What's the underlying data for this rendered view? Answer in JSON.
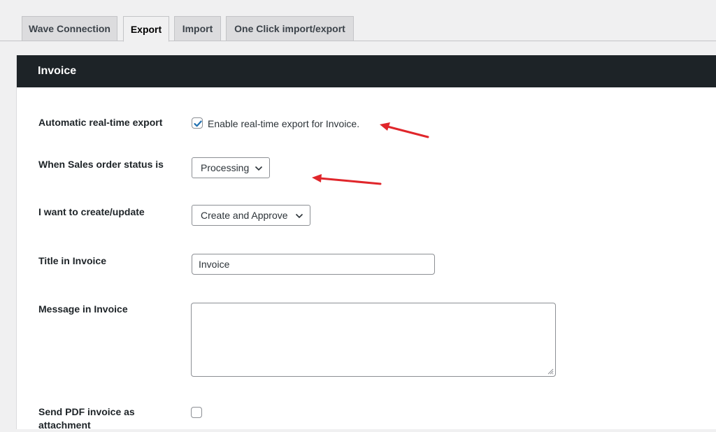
{
  "tabs": [
    {
      "label": "Wave Connection",
      "active": false
    },
    {
      "label": "Export",
      "active": true
    },
    {
      "label": "Import",
      "active": false
    },
    {
      "label": "One Click import/export",
      "active": false
    }
  ],
  "panel": {
    "title": "Invoice"
  },
  "fields": {
    "realtime": {
      "label": "Automatic real-time export",
      "checkbox_text": "Enable real-time export for Invoice.",
      "checked": true
    },
    "status": {
      "label": "When Sales order status is",
      "selected": "Processing"
    },
    "create_update": {
      "label": "I want to create/update",
      "selected": "Create and Approve"
    },
    "title": {
      "label": "Title in Invoice",
      "value": "Invoice"
    },
    "message": {
      "label": "Message in Invoice",
      "value": ""
    },
    "pdf": {
      "label": "Send PDF invoice as attachment",
      "checked": false
    }
  },
  "colors": {
    "header_bg": "#1d2327",
    "accent": "#2271b1",
    "annotation_arrow": "#e0262b"
  }
}
